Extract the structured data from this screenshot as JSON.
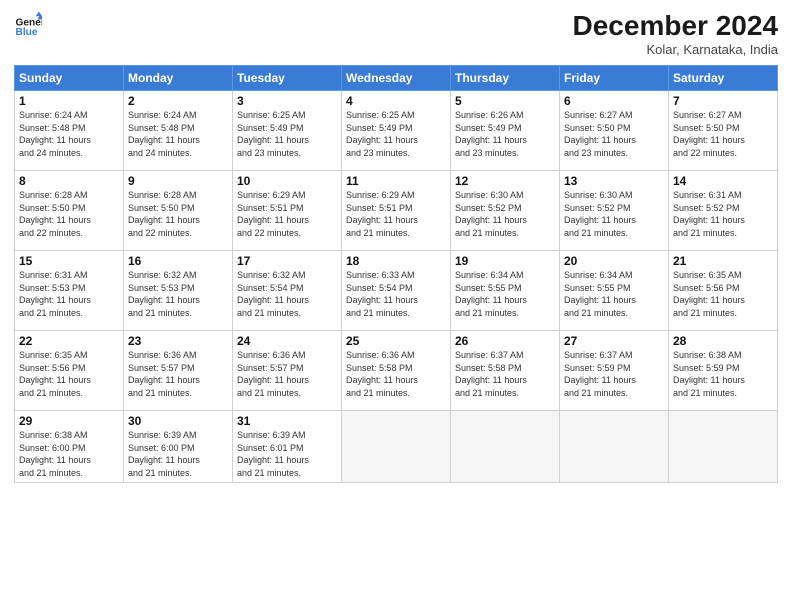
{
  "header": {
    "logo_line1": "General",
    "logo_line2": "Blue",
    "month_title": "December 2024",
    "location": "Kolar, Karnataka, India"
  },
  "weekdays": [
    "Sunday",
    "Monday",
    "Tuesday",
    "Wednesday",
    "Thursday",
    "Friday",
    "Saturday"
  ],
  "weeks": [
    [
      {
        "day": "1",
        "info": "Sunrise: 6:24 AM\nSunset: 5:48 PM\nDaylight: 11 hours\nand 24 minutes."
      },
      {
        "day": "2",
        "info": "Sunrise: 6:24 AM\nSunset: 5:48 PM\nDaylight: 11 hours\nand 24 minutes."
      },
      {
        "day": "3",
        "info": "Sunrise: 6:25 AM\nSunset: 5:49 PM\nDaylight: 11 hours\nand 23 minutes."
      },
      {
        "day": "4",
        "info": "Sunrise: 6:25 AM\nSunset: 5:49 PM\nDaylight: 11 hours\nand 23 minutes."
      },
      {
        "day": "5",
        "info": "Sunrise: 6:26 AM\nSunset: 5:49 PM\nDaylight: 11 hours\nand 23 minutes."
      },
      {
        "day": "6",
        "info": "Sunrise: 6:27 AM\nSunset: 5:50 PM\nDaylight: 11 hours\nand 23 minutes."
      },
      {
        "day": "7",
        "info": "Sunrise: 6:27 AM\nSunset: 5:50 PM\nDaylight: 11 hours\nand 22 minutes."
      }
    ],
    [
      {
        "day": "8",
        "info": "Sunrise: 6:28 AM\nSunset: 5:50 PM\nDaylight: 11 hours\nand 22 minutes."
      },
      {
        "day": "9",
        "info": "Sunrise: 6:28 AM\nSunset: 5:50 PM\nDaylight: 11 hours\nand 22 minutes."
      },
      {
        "day": "10",
        "info": "Sunrise: 6:29 AM\nSunset: 5:51 PM\nDaylight: 11 hours\nand 22 minutes."
      },
      {
        "day": "11",
        "info": "Sunrise: 6:29 AM\nSunset: 5:51 PM\nDaylight: 11 hours\nand 21 minutes."
      },
      {
        "day": "12",
        "info": "Sunrise: 6:30 AM\nSunset: 5:52 PM\nDaylight: 11 hours\nand 21 minutes."
      },
      {
        "day": "13",
        "info": "Sunrise: 6:30 AM\nSunset: 5:52 PM\nDaylight: 11 hours\nand 21 minutes."
      },
      {
        "day": "14",
        "info": "Sunrise: 6:31 AM\nSunset: 5:52 PM\nDaylight: 11 hours\nand 21 minutes."
      }
    ],
    [
      {
        "day": "15",
        "info": "Sunrise: 6:31 AM\nSunset: 5:53 PM\nDaylight: 11 hours\nand 21 minutes."
      },
      {
        "day": "16",
        "info": "Sunrise: 6:32 AM\nSunset: 5:53 PM\nDaylight: 11 hours\nand 21 minutes."
      },
      {
        "day": "17",
        "info": "Sunrise: 6:32 AM\nSunset: 5:54 PM\nDaylight: 11 hours\nand 21 minutes."
      },
      {
        "day": "18",
        "info": "Sunrise: 6:33 AM\nSunset: 5:54 PM\nDaylight: 11 hours\nand 21 minutes."
      },
      {
        "day": "19",
        "info": "Sunrise: 6:34 AM\nSunset: 5:55 PM\nDaylight: 11 hours\nand 21 minutes."
      },
      {
        "day": "20",
        "info": "Sunrise: 6:34 AM\nSunset: 5:55 PM\nDaylight: 11 hours\nand 21 minutes."
      },
      {
        "day": "21",
        "info": "Sunrise: 6:35 AM\nSunset: 5:56 PM\nDaylight: 11 hours\nand 21 minutes."
      }
    ],
    [
      {
        "day": "22",
        "info": "Sunrise: 6:35 AM\nSunset: 5:56 PM\nDaylight: 11 hours\nand 21 minutes."
      },
      {
        "day": "23",
        "info": "Sunrise: 6:36 AM\nSunset: 5:57 PM\nDaylight: 11 hours\nand 21 minutes."
      },
      {
        "day": "24",
        "info": "Sunrise: 6:36 AM\nSunset: 5:57 PM\nDaylight: 11 hours\nand 21 minutes."
      },
      {
        "day": "25",
        "info": "Sunrise: 6:36 AM\nSunset: 5:58 PM\nDaylight: 11 hours\nand 21 minutes."
      },
      {
        "day": "26",
        "info": "Sunrise: 6:37 AM\nSunset: 5:58 PM\nDaylight: 11 hours\nand 21 minutes."
      },
      {
        "day": "27",
        "info": "Sunrise: 6:37 AM\nSunset: 5:59 PM\nDaylight: 11 hours\nand 21 minutes."
      },
      {
        "day": "28",
        "info": "Sunrise: 6:38 AM\nSunset: 5:59 PM\nDaylight: 11 hours\nand 21 minutes."
      }
    ],
    [
      {
        "day": "29",
        "info": "Sunrise: 6:38 AM\nSunset: 6:00 PM\nDaylight: 11 hours\nand 21 minutes."
      },
      {
        "day": "30",
        "info": "Sunrise: 6:39 AM\nSunset: 6:00 PM\nDaylight: 11 hours\nand 21 minutes."
      },
      {
        "day": "31",
        "info": "Sunrise: 6:39 AM\nSunset: 6:01 PM\nDaylight: 11 hours\nand 21 minutes."
      },
      {
        "day": "",
        "info": ""
      },
      {
        "day": "",
        "info": ""
      },
      {
        "day": "",
        "info": ""
      },
      {
        "day": "",
        "info": ""
      }
    ]
  ]
}
